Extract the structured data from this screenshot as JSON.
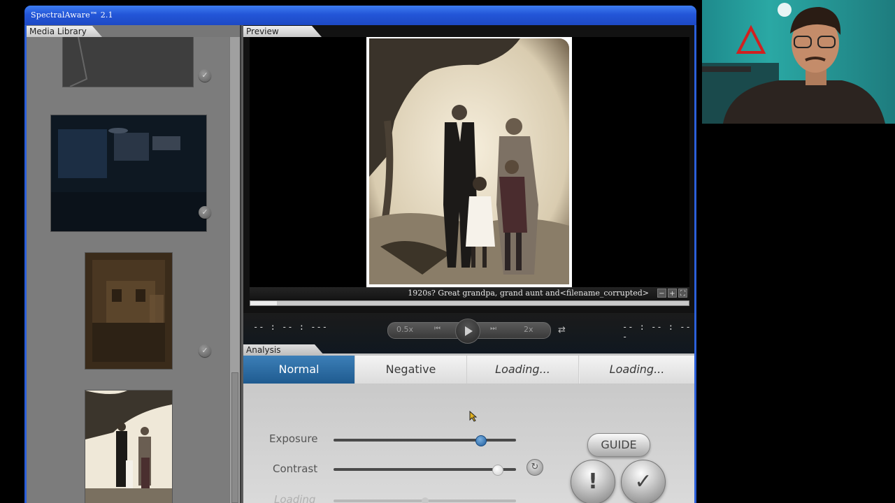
{
  "window": {
    "title": "SpectralAware™ 2.1"
  },
  "library": {
    "label": "Media Library",
    "items": [
      {
        "name": "library-thumb-1",
        "checked": true
      },
      {
        "name": "library-thumb-2",
        "checked": true
      },
      {
        "name": "library-thumb-3",
        "checked": true
      },
      {
        "name": "library-thumb-4",
        "checked": false
      }
    ]
  },
  "preview": {
    "label": "Preview",
    "caption": "1920s? Great grandpa, grand aunt and<filename_corrupted>",
    "zoom_out": "−",
    "zoom_in": "+",
    "fullscreen": "⛶",
    "progress": 0.06
  },
  "transport": {
    "time_left": "-- : -- : ---",
    "time_right": "-- : -- : ---",
    "speed_half": "0.5x",
    "speed_double": "2x",
    "prev": "⏮",
    "next": "⏭",
    "loop": "⇄"
  },
  "analysis": {
    "label": "Analysis",
    "tabs": [
      "Normal",
      "Negative",
      "Loading...",
      "Loading..."
    ],
    "active_tab": 0,
    "exposure_label": "Exposure",
    "exposure_value": 0.81,
    "contrast_label": "Contrast",
    "contrast_value": 0.9,
    "third_label": "Loading",
    "third_value": 0.5,
    "reset": "↻",
    "guide": "GUIDE",
    "alert": "!",
    "confirm": "✓"
  },
  "colors": {
    "titlebar": "#2356d8",
    "active_tab": "#1f5b90",
    "slider_knob": "#1d5a9a"
  }
}
